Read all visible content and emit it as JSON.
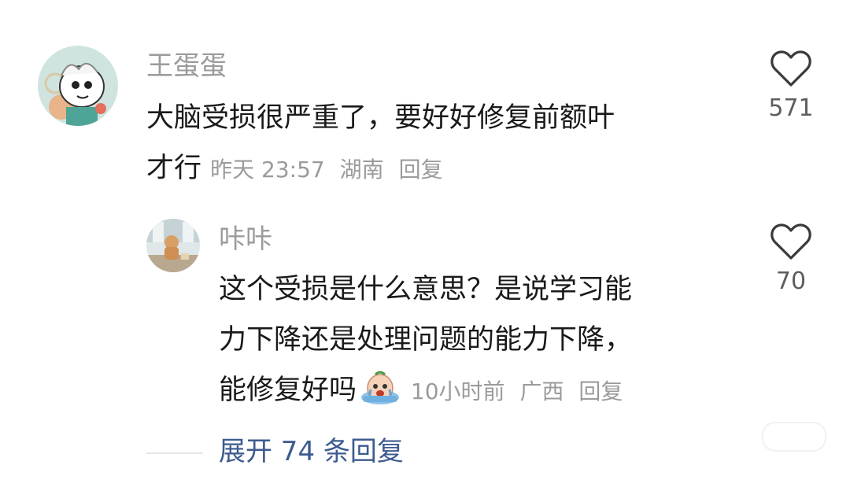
{
  "comments": [
    {
      "username": "王蛋蛋",
      "text_line1": "大脑受损很严重了，要好好修复前额叶",
      "text_line2": "才行",
      "time": "昨天 23:57",
      "location": "湖南",
      "reply_label": "回复",
      "likes": "571"
    },
    {
      "username": "咔咔",
      "text_line1": "这个受损是什么意思？是说学习能",
      "text_line2": "力下降还是处理问题的能力下降，",
      "text_line3": "能修复好吗",
      "time": "10小时前",
      "location": "广西",
      "reply_label": "回复",
      "likes": "70"
    }
  ],
  "expand_replies": "展开 74 条回复",
  "icons": {
    "like": "heart-outline-icon",
    "inline_emoji": "crying-emoji-icon"
  },
  "colors": {
    "username": "#9b9b9b",
    "text": "#1a1a1a",
    "meta": "#9b9b9b",
    "link": "#3d5b8f"
  }
}
